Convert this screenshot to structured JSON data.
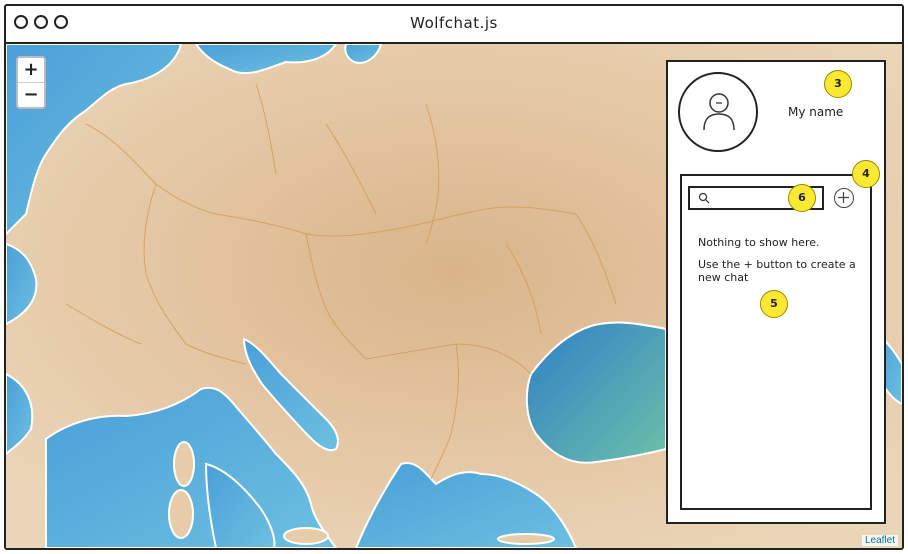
{
  "window": {
    "title": "Wolfchat.js"
  },
  "map": {
    "zoom_in_label": "+",
    "zoom_out_label": "−",
    "attribution": "Leaflet",
    "colors": {
      "land": "#e4c8a4",
      "water": "#4aa3d8",
      "water_light": "#7fc3e0",
      "sea_green": "#5bb0a0",
      "border": "#d49a55"
    }
  },
  "sidebar": {
    "username": "My name",
    "search": {
      "placeholder": "",
      "value": ""
    },
    "add_button_icon": "plus-circle-icon",
    "empty_title": "Nothing to show here.",
    "empty_hint": "Use the + button to create a new chat"
  },
  "annotations": {
    "profile": "3",
    "add": "4",
    "list": "5",
    "search": "6",
    "color": "#fbe832"
  }
}
